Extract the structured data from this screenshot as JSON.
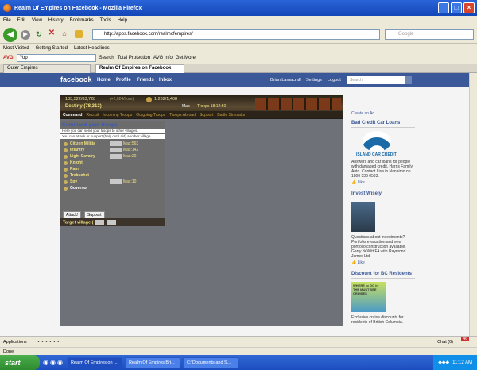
{
  "window": {
    "title": "Realm Of Empires on Facebook - Mozilla Firefox"
  },
  "menu": [
    "File",
    "Edit",
    "View",
    "History",
    "Bookmarks",
    "Tools",
    "Help"
  ],
  "nav": {
    "url": "http://apps.facebook.com/realmofempires/",
    "search_placeholder": "Google"
  },
  "bookmarks": [
    "Most Visited",
    "Getting Started",
    "Latest Headlines"
  ],
  "avg": {
    "label": "AVG",
    "input": "Yop",
    "items": [
      "Search",
      "Total Protection",
      "AVG Info",
      "Get More"
    ]
  },
  "tabs": [
    {
      "label": "Outer Empires"
    },
    {
      "label": "Realm Of Empires on Facebook"
    }
  ],
  "fb": {
    "logo": "facebook",
    "nav": [
      "Home",
      "Profile",
      "Friends",
      "Inbox"
    ],
    "user": "Brian Lamacraft",
    "settings": "Settings",
    "logout": "Logout",
    "search_placeholder": "Search"
  },
  "game": {
    "silver": "183,522/63,728",
    "rate": "(+2,024/hour)",
    "food": "1,262/1,408",
    "village": "Destiny (78,313)",
    "map": "Map",
    "troops_timer": "Troops 18:12:50",
    "tabs": [
      "Command",
      "Recruit",
      "Incoming Troops",
      "Outgoing Troops",
      "Troops Abroad",
      "Support",
      "Battle Simulator"
    ],
    "panel_title": "Command your troops",
    "info1": "Here you can send your troops to other villages.",
    "info2": "You can attack or support (help out / aid) another village.",
    "troops": [
      {
        "name": "Citizen Militia",
        "max": "Max:563"
      },
      {
        "name": "Infantry",
        "max": "Max:142"
      },
      {
        "name": "Light Cavalry",
        "max": "Max:20"
      },
      {
        "name": "Knight",
        "max": ""
      },
      {
        "name": "Ram",
        "max": ""
      },
      {
        "name": "Trebuchet",
        "max": ""
      },
      {
        "name": "Spy",
        "max": "Max:10"
      },
      {
        "name": "Governor",
        "max": ""
      }
    ],
    "target": "Target village (",
    "attack": "Attack!",
    "support": "Support"
  },
  "sidebar": {
    "create_ad": "Create an Ad",
    "ad1": {
      "title": "Bad Credit Car Loans",
      "logo": "ISLAND CAR CREDIT",
      "text": "Answers and car loans for people with damaged credit. Harris Family Auto. Contact Lisa in Nanaimo on 1800 536 0583.",
      "like": "Like"
    },
    "ad2": {
      "title": "Invest Wisely",
      "text": "Questions about investments? Portfolio evaluation and new portfolio construction available. Garry deWitt FA with Raymond James Ltd.",
      "like": "Like"
    },
    "ad3": {
      "title": "Discount for BC Residents",
      "book": "WHERE to GO in THE MUST SEE CRUISES",
      "text": "Exclusive cruise discounts for residents of British Columbia."
    }
  },
  "bottom": {
    "apps": "Applications",
    "chat": "Chat",
    "chat_count": "(0)",
    "notify": "46"
  },
  "status": "Done",
  "taskbar": {
    "start": "start",
    "tasks": [
      "Realm Of Empires on ...",
      "Realm Of Empires Bri...",
      "C:\\Documents and S..."
    ],
    "time": "11:12 AM"
  }
}
